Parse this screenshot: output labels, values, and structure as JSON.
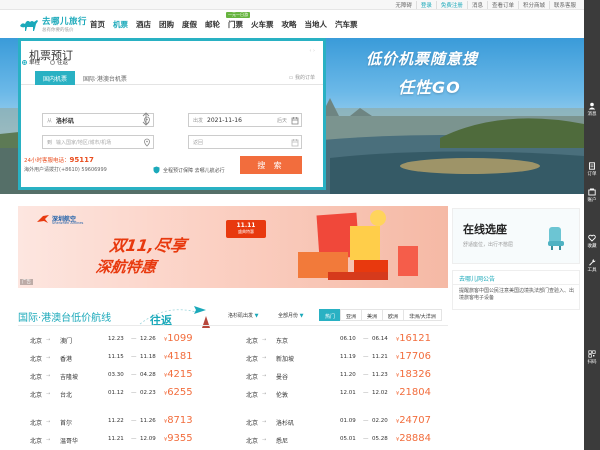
{
  "topbar": {
    "links": [
      "无障碍",
      "登录",
      "免费注册",
      "消息",
      "查看订单",
      "积分商城",
      "联系客服"
    ]
  },
  "brand": {
    "name": "去哪儿旅行",
    "sub": "总有你要的低价"
  },
  "nav": {
    "items": [
      "首页",
      "机票",
      "酒店",
      "团购",
      "度假",
      "邮轮",
      "门票",
      "火车票",
      "攻略",
      "当地人",
      "汽车票"
    ],
    "active": "机票",
    "badge": "一元一日游"
  },
  "banner": {
    "slogan1": "低价机票随意搜",
    "slogan2": "任性GO"
  },
  "search": {
    "title": "机票预订",
    "tabs": [
      "国内机票",
      "国际·港澳台机票"
    ],
    "my_order": "我的订单",
    "trip_types": [
      "单程",
      "往返"
    ],
    "from_prefix": "从",
    "from_value": "洛杉矶",
    "to_prefix": "到",
    "to_placeholder": "输入国家/地区/城市/机场",
    "depart_prefix": "出发",
    "depart_value": "2021-11-16",
    "depart_suffix": "后天",
    "return_prefix": "返回",
    "hotline_label": "24小时客服电话：",
    "hotline_number": "95117",
    "overseas": "海外用户请拨打(+8610) 59606999",
    "guarantee": "全程预订保障 去哪儿航必行",
    "button": "搜 索"
  },
  "ad": {
    "airline": "深圳航空",
    "airline_en": "Shenzhen Airlines",
    "line1": "双11,尽享",
    "line2": "深航特惠",
    "tag": "广告",
    "promo": "11.11",
    "promo_sub": "盛典特惠"
  },
  "seat": {
    "title": "在线选座",
    "subtitle": "舒适座位，出行不憋屈"
  },
  "notice": {
    "title": "去哪儿网公告",
    "body": "提醒旅客中国公民注意美国边境执法部门查验入、出境旅客电子设备"
  },
  "lowprice": {
    "title": "国际·港澳台低价航线",
    "roundtrip": "往返",
    "depart_city": "洛杉矶出发",
    "month": "全部月份",
    "regions": [
      "热门",
      "亚洲",
      "美洲",
      "欧洲",
      "非洲/大洋洲"
    ],
    "active_region": "热门"
  },
  "routes_left": [
    {
      "from": "北京",
      "to": "澳门",
      "d1": "12.23",
      "d2": "12.26",
      "price": "1099"
    },
    {
      "from": "北京",
      "to": "香港",
      "d1": "11.15",
      "d2": "11.18",
      "price": "4181"
    },
    {
      "from": "北京",
      "to": "吉隆坡",
      "d1": "03.30",
      "d2": "04.28",
      "price": "4215"
    },
    {
      "from": "北京",
      "to": "台北",
      "d1": "01.12",
      "d2": "02.23",
      "price": "6255"
    },
    {
      "from": "北京",
      "to": "首尔",
      "d1": "11.22",
      "d2": "11.26",
      "price": "8713"
    },
    {
      "from": "北京",
      "to": "温哥华",
      "d1": "11.21",
      "d2": "12.09",
      "price": "9355"
    }
  ],
  "routes_right": [
    {
      "from": "北京",
      "to": "东京",
      "d1": "06.10",
      "d2": "06.14",
      "price": "16121"
    },
    {
      "from": "北京",
      "to": "新加坡",
      "d1": "11.19",
      "d2": "11.21",
      "price": "17706"
    },
    {
      "from": "北京",
      "to": "曼谷",
      "d1": "11.20",
      "d2": "11.23",
      "price": "18326"
    },
    {
      "from": "北京",
      "to": "伦敦",
      "d1": "12.01",
      "d2": "12.02",
      "price": "21804"
    },
    {
      "from": "北京",
      "to": "洛杉矶",
      "d1": "01.09",
      "d2": "02.20",
      "price": "24707"
    },
    {
      "from": "北京",
      "to": "悉尼",
      "d1": "05.01",
      "d2": "05.28",
      "price": "28884"
    }
  ],
  "currency": "¥",
  "route_arrow": "→",
  "date_sep": "—",
  "sidebar": [
    "消息",
    "订单",
    "账户",
    "收藏",
    "工具",
    "扫码"
  ],
  "colors": {
    "accent": "#1ba9ba",
    "orange": "#f26d3d",
    "sidebar": "#3b3b3b"
  }
}
